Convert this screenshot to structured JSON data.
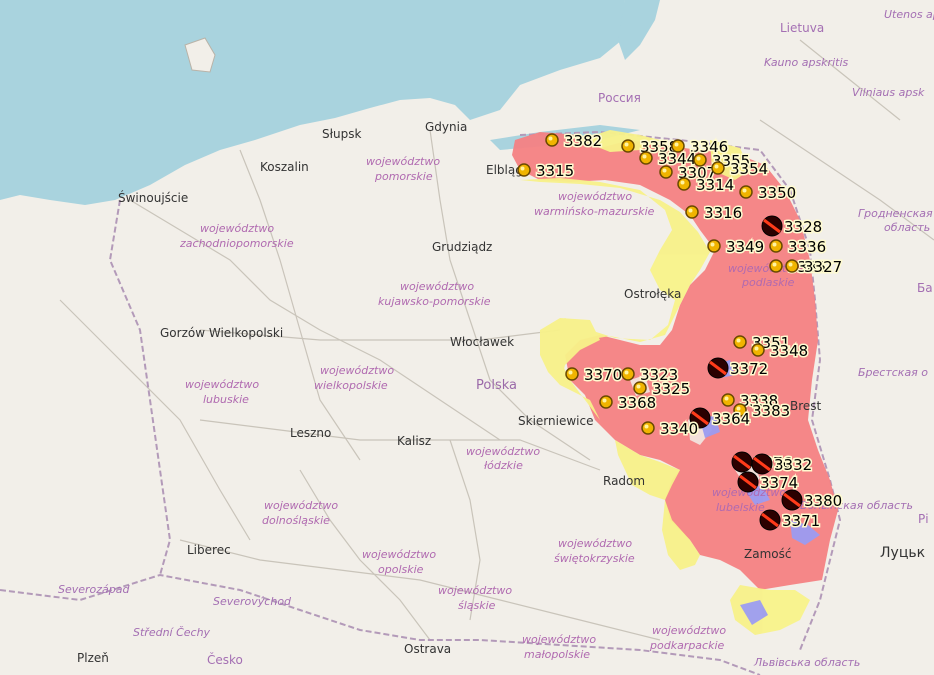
{
  "colors": {
    "water": "#a9d3de",
    "land": "#f2efe9",
    "red_zone": "#f48183",
    "yellow_zone": "#f8f28a",
    "blue_zone": "#9c9cf2",
    "gold_marker": "#f0b400",
    "dark_marker": "#2b0000"
  },
  "cities": [
    {
      "name": "Słupsk"
    },
    {
      "name": "Gdynia"
    },
    {
      "name": "Koszalin"
    },
    {
      "name": "Elbląg"
    },
    {
      "name": "Świnoujście"
    },
    {
      "name": "Grudziądz"
    },
    {
      "name": "Ostrołęka"
    },
    {
      "name": "Gorzów Wielkopolski"
    },
    {
      "name": "Włocławek"
    },
    {
      "name": "Polska"
    },
    {
      "name": "Skierniewice"
    },
    {
      "name": "Leszno"
    },
    {
      "name": "Kalisz"
    },
    {
      "name": "Radom"
    },
    {
      "name": "Liberec"
    },
    {
      "name": "Zamość"
    },
    {
      "name": "Plzeň"
    },
    {
      "name": "Ostrava"
    }
  ],
  "regions": [
    {
      "line1": "województwo",
      "line2": "pomorskie"
    },
    {
      "line1": "województwo",
      "line2": "zachodniopomorskie"
    },
    {
      "line1": "województwo",
      "line2": "warmińsko-mazurskie"
    },
    {
      "line1": "województwo",
      "line2": "kujawsko-pomorskie"
    },
    {
      "line1": "województwo",
      "line2": "podlaskie"
    },
    {
      "line1": "województwo",
      "line2": "lubuskie"
    },
    {
      "line1": "województwo",
      "line2": "wielkopolskie"
    },
    {
      "line1": "województwo",
      "line2": "łódzkie"
    },
    {
      "line1": "województwo",
      "line2": "lubelskie"
    },
    {
      "line1": "województwo",
      "line2": "dolnośląskie"
    },
    {
      "line1": "województwo",
      "line2": "opolskie"
    },
    {
      "line1": "województwo",
      "line2": "świętokrzyskie"
    },
    {
      "line1": "województwo",
      "line2": "śląskie"
    },
    {
      "line1": "województwo",
      "line2": "małopolskie"
    },
    {
      "line1": "województwo",
      "line2": "podkarpackie"
    }
  ],
  "foreign_labels": [
    {
      "name": "Россия"
    },
    {
      "name": "Lietuva"
    },
    {
      "name": "Utenos ap"
    },
    {
      "name": "Kauno apskritis"
    },
    {
      "name": "Vilniaus apsk"
    },
    {
      "name": "Гродненская",
      "name2": "область"
    },
    {
      "name": "Брестская о"
    },
    {
      "name": "Ба"
    },
    {
      "name": "Волынская область"
    },
    {
      "name": "Рі"
    },
    {
      "name": "Луцьк"
    },
    {
      "name": "Львівська область"
    },
    {
      "name": "Severozápad"
    },
    {
      "name": "Severovýchod"
    },
    {
      "name": "Střední Čechy"
    },
    {
      "name": "Česko"
    },
    {
      "name": "Brest"
    }
  ],
  "markers": [
    {
      "id": "3382",
      "type": "gold"
    },
    {
      "id": "3358",
      "type": "gold"
    },
    {
      "id": "3346",
      "type": "gold"
    },
    {
      "id": "3344",
      "type": "gold"
    },
    {
      "id": "3307",
      "type": "gold"
    },
    {
      "id": "3355",
      "type": "gold"
    },
    {
      "id": "3354",
      "type": "gold"
    },
    {
      "id": "3315",
      "type": "gold"
    },
    {
      "id": "3314",
      "type": "gold"
    },
    {
      "id": "3350",
      "type": "gold"
    },
    {
      "id": "3316",
      "type": "gold"
    },
    {
      "id": "3328",
      "type": "dark"
    },
    {
      "id": "3349",
      "type": "gold"
    },
    {
      "id": "3336",
      "type": "gold"
    },
    {
      "id": "3385",
      "type": "gold"
    },
    {
      "id": "3327",
      "type": "gold"
    },
    {
      "id": "3351",
      "type": "gold"
    },
    {
      "id": "3348",
      "type": "gold"
    },
    {
      "id": "3370",
      "type": "gold"
    },
    {
      "id": "3323",
      "type": "gold"
    },
    {
      "id": "3372",
      "type": "dark"
    },
    {
      "id": "3325",
      "type": "gold"
    },
    {
      "id": "3368",
      "type": "gold"
    },
    {
      "id": "3338",
      "type": "gold"
    },
    {
      "id": "3383",
      "type": "gold"
    },
    {
      "id": "3364",
      "type": "dark"
    },
    {
      "id": "3340",
      "type": "gold"
    },
    {
      "id": "3376",
      "type": "dark"
    },
    {
      "id": "3332",
      "type": "dark"
    },
    {
      "id": "3374",
      "type": "dark"
    },
    {
      "id": "3380",
      "type": "dark"
    },
    {
      "id": "3371",
      "type": "dark"
    }
  ]
}
